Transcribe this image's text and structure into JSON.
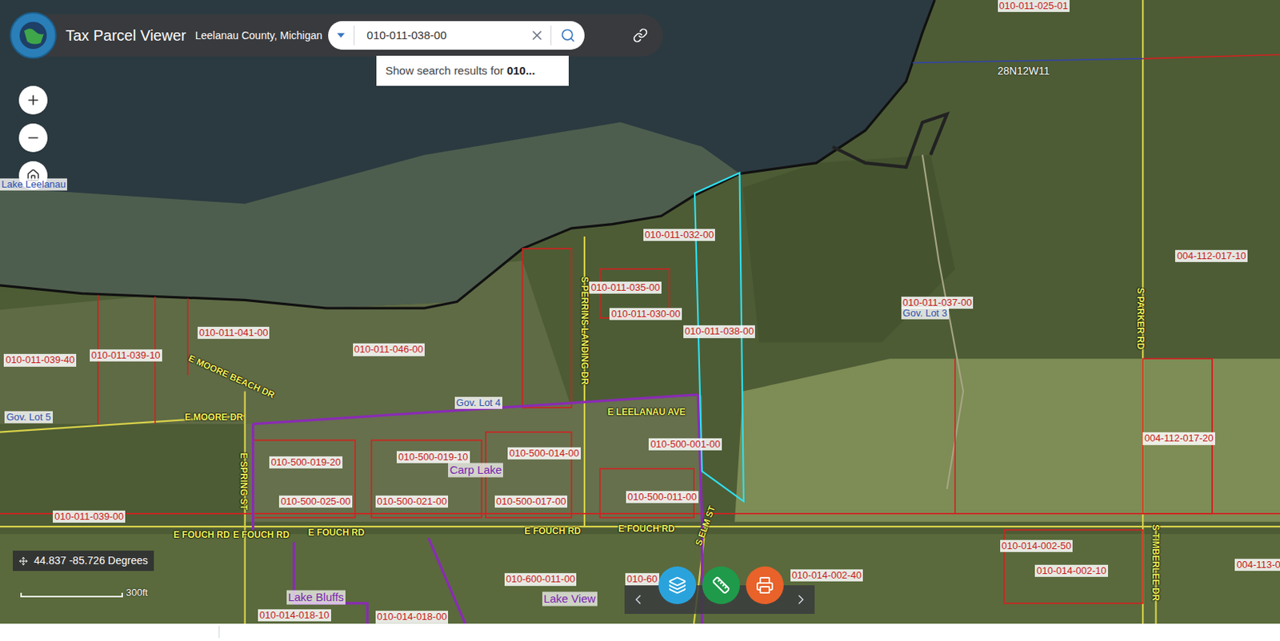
{
  "header": {
    "title": "Tax Parcel Viewer",
    "county": "Leelanau County, Michigan",
    "search_value": "010-011-038-00"
  },
  "suggestion": {
    "prefix": "Show search results for ",
    "query": "010..."
  },
  "lake_label": "Lake Leelanau",
  "township": "28N12W11",
  "parcels": [
    {
      "label": "010-011-025-01",
      "selected": false
    },
    {
      "label": "010-011-032-00",
      "selected": false
    },
    {
      "label": "010-011-035-00",
      "selected": false
    },
    {
      "label": "010-011-030-00",
      "selected": false
    },
    {
      "label": "010-011-038-00",
      "selected": true
    },
    {
      "label": "010-011-037-00",
      "selected": false
    },
    {
      "label": "004-112-017-10",
      "selected": false
    },
    {
      "label": "010-011-041-00",
      "selected": false
    },
    {
      "label": "010-011-046-00",
      "selected": false
    },
    {
      "label": "010-011-039-40",
      "selected": false
    },
    {
      "label": "010-011-039-10",
      "selected": false
    },
    {
      "label": "010-500-001-00",
      "selected": false
    },
    {
      "label": "010-500-019-20",
      "selected": false
    },
    {
      "label": "010-500-019-10",
      "selected": false
    },
    {
      "label": "010-500-014-00",
      "selected": false
    },
    {
      "label": "010-500-025-00",
      "selected": false
    },
    {
      "label": "010-500-021-00",
      "selected": false
    },
    {
      "label": "010-500-017-00",
      "selected": false
    },
    {
      "label": "010-500-011-00",
      "selected": false
    },
    {
      "label": "004-112-017-20",
      "selected": false
    },
    {
      "label": "010-011-039-00",
      "selected": false
    },
    {
      "label": "010-014-002-50",
      "selected": false
    },
    {
      "label": "010-014-002-10",
      "selected": false
    },
    {
      "label": "010-014-002-40",
      "selected": false
    },
    {
      "label": "004-113-0",
      "selected": false
    },
    {
      "label": "010-600-011-00",
      "selected": false
    },
    {
      "label": "010-60",
      "selected": false
    },
    {
      "label": "010-014-018-10",
      "selected": false
    },
    {
      "label": "010-014-018-00",
      "selected": false
    }
  ],
  "streets": [
    {
      "label": "S PERRINS LANDING DR"
    },
    {
      "label": "E MOORE BEACH DR"
    },
    {
      "label": "E MOORE DR"
    },
    {
      "label": "E SPRING ST"
    },
    {
      "label": "E LEELANAU AVE"
    },
    {
      "label": "E FOUCH RD"
    },
    {
      "label": "E FOUCH RD"
    },
    {
      "label": "E FOUCH RD"
    },
    {
      "label": "E FOUCH RD"
    },
    {
      "label": "E FOUCH RD"
    },
    {
      "label": "S ELM ST"
    },
    {
      "label": "S PARKER RD"
    },
    {
      "label": "S TIMBERLEE DR"
    }
  ],
  "subdivisions": [
    {
      "label": "Carp Lake"
    },
    {
      "label": "Lake Bluffs"
    },
    {
      "label": "Lake View"
    }
  ],
  "gov_lots": [
    {
      "label": "Gov. Lot 5"
    },
    {
      "label": "Gov. Lot 4"
    },
    {
      "label": "Gov. Lot 3"
    }
  ],
  "coordinates": "44.837 -85.726 Degrees",
  "scale": "300ft"
}
